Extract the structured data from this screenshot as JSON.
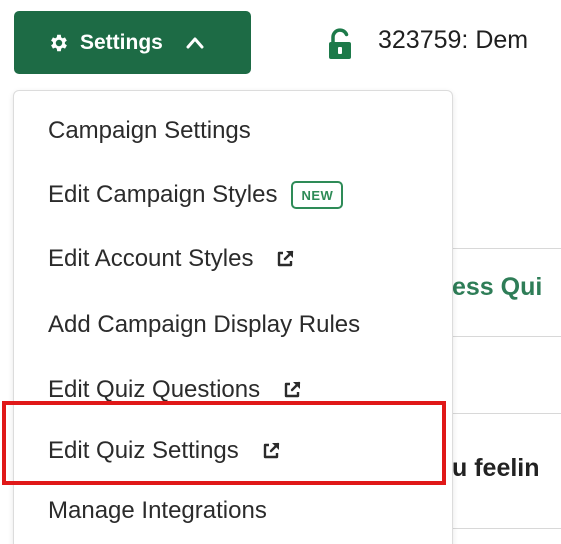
{
  "header": {
    "settings_label": "Settings",
    "campaign_title": "323759: Dem"
  },
  "background": {
    "text_1": "ess Qui",
    "text_2": "u feelin"
  },
  "menu": {
    "items": [
      {
        "label": "Campaign Settings"
      },
      {
        "label": "Edit Campaign Styles",
        "badge": "NEW"
      },
      {
        "label": "Edit Account Styles"
      },
      {
        "label": "Add Campaign Display Rules"
      },
      {
        "label": "Edit Quiz Questions"
      },
      {
        "label": "Edit Quiz Settings"
      },
      {
        "label": "Manage Integrations"
      }
    ]
  },
  "colors": {
    "brand_green": "#1d6b45",
    "badge_green": "#2e8b57",
    "highlight_red": "#e01818"
  },
  "icons": {
    "settings": "gear-icon",
    "settings_toggle": "chevron-up-icon",
    "lock": "unlocked-lock-icon",
    "external": "external-link-icon"
  }
}
